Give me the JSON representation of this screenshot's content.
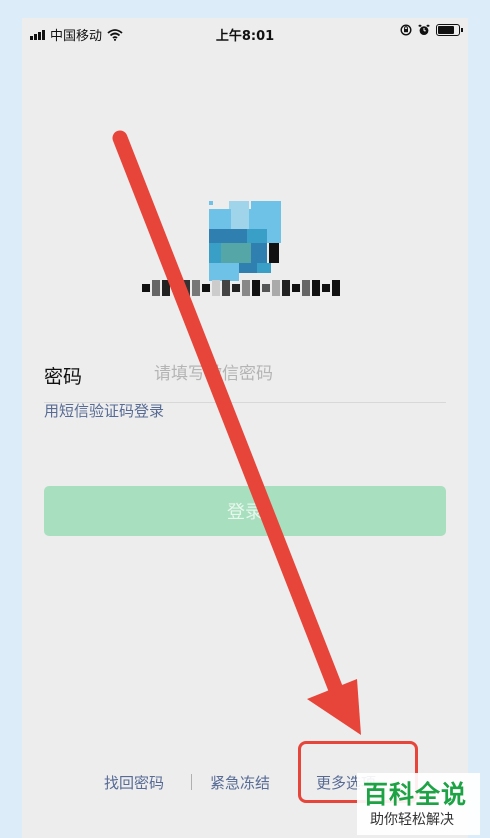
{
  "status_bar": {
    "carrier": "中国移动",
    "time": "上午8:01",
    "signal_bars": 4,
    "battery_level": 0.85,
    "icons": [
      "wifi-icon",
      "orientation-lock-icon",
      "alarm-icon",
      "battery-icon"
    ]
  },
  "profile": {
    "avatar_colors": [
      "#6ec2e8",
      "#3a9fc7",
      "#9fd4ea",
      "#2f7fb0",
      "#55a6a6",
      "#111111"
    ]
  },
  "password": {
    "label": "密码",
    "placeholder": "请填写微信密码",
    "value": ""
  },
  "sms_login_link": "用短信验证码登录",
  "login_button": "登录",
  "bottom_links": {
    "recover_password": "找回密码",
    "separator": "|",
    "emergency_freeze": "紧急冻结",
    "more_options": "更多选项"
  },
  "annotation": {
    "arrow_color": "#e8453a",
    "box_color": "#e8453a"
  },
  "watermark": {
    "title": "百科全说",
    "subtitle": "助你轻松解决"
  }
}
